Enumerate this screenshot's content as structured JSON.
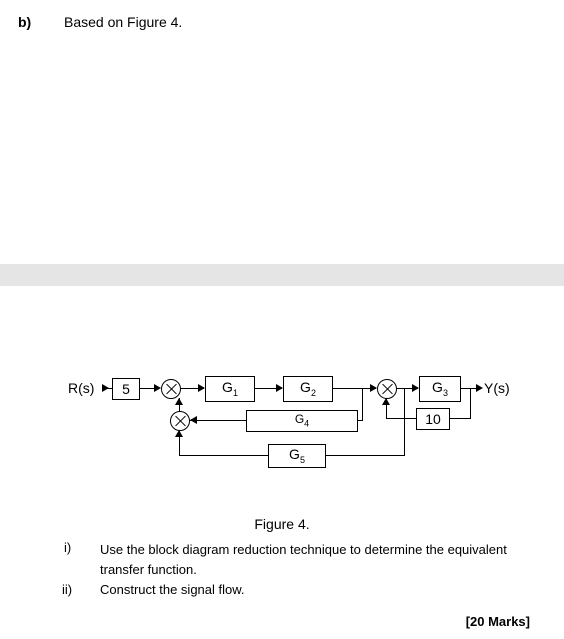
{
  "question": {
    "part_label": "b)",
    "intro": "Based on Figure 4."
  },
  "diagram": {
    "input_label": "R(s)",
    "output_label": "Y(s)",
    "blocks": {
      "gain": "5",
      "G1": "G",
      "G1_sub": "1",
      "G2": "G",
      "G2_sub": "2",
      "G3": "G",
      "G3_sub": "3",
      "G4": "G",
      "G4_sub": "4",
      "G5": "G",
      "G5_sub": "5",
      "ten": "10"
    },
    "caption": "Figure 4."
  },
  "subparts": {
    "i_label": "i)",
    "i_text": "Use the block diagram reduction technique to determine the equivalent transfer function.",
    "ii_label": "ii)",
    "ii_text": "Construct the signal flow."
  },
  "marks": "[20 Marks]"
}
